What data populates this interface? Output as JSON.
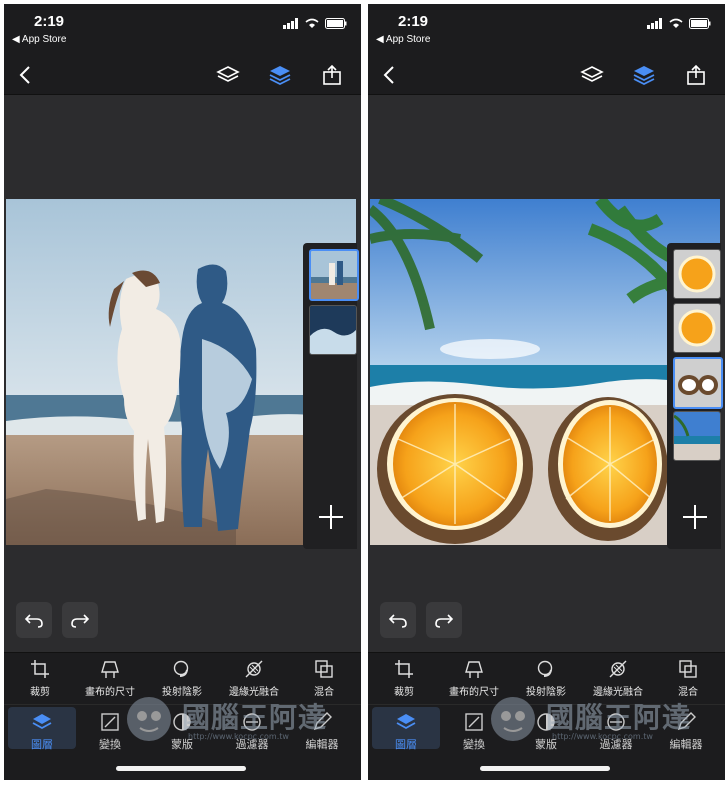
{
  "status": {
    "time": "2:19",
    "back_label": "◀ App Store"
  },
  "toolbar": {
    "items": [
      {
        "label": "裁剪",
        "icon": "crop-icon"
      },
      {
        "label": "畫布的尺寸",
        "icon": "canvas-size-icon"
      },
      {
        "label": "投射陰影",
        "icon": "drop-shadow-icon"
      },
      {
        "label": "邊緣光融合",
        "icon": "edge-blend-icon"
      },
      {
        "label": "混合",
        "icon": "blend-icon"
      }
    ]
  },
  "tabs": [
    {
      "label": "圖層",
      "icon": "layers-icon",
      "active": true
    },
    {
      "label": "變換",
      "icon": "transform-icon",
      "active": false
    },
    {
      "label": "蒙版",
      "icon": "mask-icon",
      "active": false
    },
    {
      "label": "過濾器",
      "icon": "filter-icon",
      "active": false
    },
    {
      "label": "編輯器",
      "icon": "editor-icon",
      "active": false
    }
  ],
  "watermark": {
    "text": "國腦王阿達",
    "url": "http://www.kocpc.com.tw"
  },
  "colors": {
    "accent": "#4a8ef5",
    "panel": "#1c1c1e",
    "background": "#2c2c2e"
  }
}
